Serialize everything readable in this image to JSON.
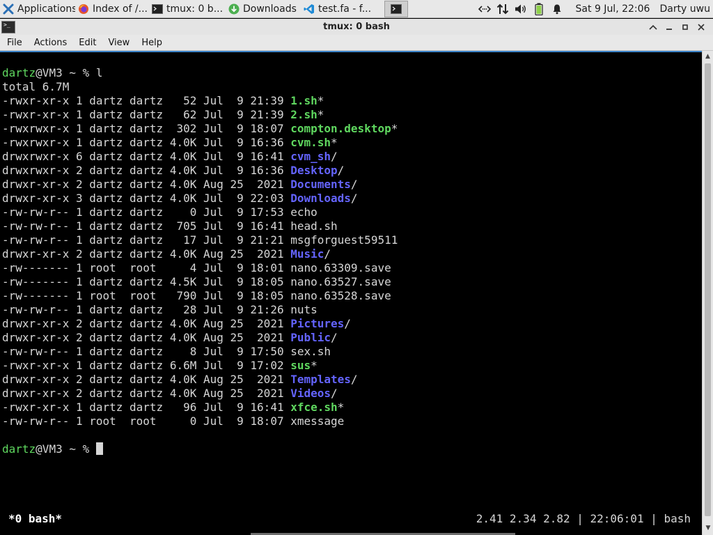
{
  "panel": {
    "tasks": [
      {
        "label": "Applications",
        "icon": "xfce-mouse-icon",
        "active": false
      },
      {
        "label": "Index of /...",
        "icon": "firefox-icon",
        "active": false
      },
      {
        "label": "tmux: 0 b...",
        "icon": "terminal-icon",
        "active": false
      },
      {
        "label": "Downloads",
        "icon": "download-folder-icon",
        "active": false
      },
      {
        "label": "test.fa - f...",
        "icon": "vscode-icon",
        "active": false
      },
      {
        "label": "",
        "icon": "terminal-icon",
        "active": true
      }
    ],
    "tray": [
      "network-icon",
      "transfer-icon",
      "volume-icon",
      "battery-icon",
      "notification-bell-icon"
    ],
    "clock": "Sat  9 Jul, 22:06",
    "user": "Darty uwu"
  },
  "window": {
    "title": "tmux: 0 bash",
    "menu": [
      "File",
      "Actions",
      "Edit",
      "View",
      "Help"
    ]
  },
  "terminal": {
    "prompt_user": "dartz",
    "prompt_host": "@VM3 ~ % ",
    "command": "l",
    "total": "total 6.7M",
    "entries": [
      {
        "meta": "-rwxr-xr-x 1 dartz dartz   52 Jul  9 21:39 ",
        "name": "1.sh",
        "suffix": "*",
        "kind": "exe"
      },
      {
        "meta": "-rwxr-xr-x 1 dartz dartz   62 Jul  9 21:39 ",
        "name": "2.sh",
        "suffix": "*",
        "kind": "exe"
      },
      {
        "meta": "-rwxrwxr-x 1 dartz dartz  302 Jul  9 18:07 ",
        "name": "compton.desktop",
        "suffix": "*",
        "kind": "exe"
      },
      {
        "meta": "-rwxrwxr-x 1 dartz dartz 4.0K Jul  9 16:36 ",
        "name": "cvm.sh",
        "suffix": "*",
        "kind": "exe"
      },
      {
        "meta": "drwxrwxr-x 6 dartz dartz 4.0K Jul  9 16:41 ",
        "name": "cvm_sh",
        "suffix": "/",
        "kind": "dir"
      },
      {
        "meta": "drwxrwxr-x 2 dartz dartz 4.0K Jul  9 16:36 ",
        "name": "Desktop",
        "suffix": "/",
        "kind": "dir"
      },
      {
        "meta": "drwxr-xr-x 2 dartz dartz 4.0K Aug 25  2021 ",
        "name": "Documents",
        "suffix": "/",
        "kind": "dir"
      },
      {
        "meta": "drwxr-xr-x 3 dartz dartz 4.0K Jul  9 22:03 ",
        "name": "Downloads",
        "suffix": "/",
        "kind": "dir"
      },
      {
        "meta": "-rw-rw-r-- 1 dartz dartz    0 Jul  9 17:53 ",
        "name": "echo",
        "suffix": "",
        "kind": "file"
      },
      {
        "meta": "-rw-rw-r-- 1 dartz dartz  705 Jul  9 16:41 ",
        "name": "head.sh",
        "suffix": "",
        "kind": "file"
      },
      {
        "meta": "-rw-rw-r-- 1 dartz dartz   17 Jul  9 21:21 ",
        "name": "msgforguest59511",
        "suffix": "",
        "kind": "file"
      },
      {
        "meta": "drwxr-xr-x 2 dartz dartz 4.0K Aug 25  2021 ",
        "name": "Music",
        "suffix": "/",
        "kind": "dir"
      },
      {
        "meta": "-rw------- 1 root  root     4 Jul  9 18:01 ",
        "name": "nano.63309.save",
        "suffix": "",
        "kind": "file"
      },
      {
        "meta": "-rw------- 1 dartz dartz 4.5K Jul  9 18:05 ",
        "name": "nano.63527.save",
        "suffix": "",
        "kind": "file"
      },
      {
        "meta": "-rw------- 1 root  root   790 Jul  9 18:05 ",
        "name": "nano.63528.save",
        "suffix": "",
        "kind": "file"
      },
      {
        "meta": "-rw-rw-r-- 1 dartz dartz   28 Jul  9 21:26 ",
        "name": "nuts",
        "suffix": "",
        "kind": "file"
      },
      {
        "meta": "drwxr-xr-x 2 dartz dartz 4.0K Aug 25  2021 ",
        "name": "Pictures",
        "suffix": "/",
        "kind": "dir"
      },
      {
        "meta": "drwxr-xr-x 2 dartz dartz 4.0K Aug 25  2021 ",
        "name": "Public",
        "suffix": "/",
        "kind": "dir"
      },
      {
        "meta": "-rw-rw-r-- 1 dartz dartz    8 Jul  9 17:50 ",
        "name": "sex.sh",
        "suffix": "",
        "kind": "file"
      },
      {
        "meta": "-rwxr-xr-x 1 dartz dartz 6.6M Jul  9 17:02 ",
        "name": "sus",
        "suffix": "*",
        "kind": "exe"
      },
      {
        "meta": "drwxr-xr-x 2 dartz dartz 4.0K Aug 25  2021 ",
        "name": "Templates",
        "suffix": "/",
        "kind": "dir"
      },
      {
        "meta": "drwxr-xr-x 2 dartz dartz 4.0K Aug 25  2021 ",
        "name": "Videos",
        "suffix": "/",
        "kind": "dir"
      },
      {
        "meta": "-rwxr-xr-x 1 dartz dartz   96 Jul  9 16:41 ",
        "name": "xfce.sh",
        "suffix": "*",
        "kind": "exe"
      },
      {
        "meta": "-rw-rw-r-- 1 root  root     0 Jul  9 18:07 ",
        "name": "xmessage",
        "suffix": "",
        "kind": "file"
      }
    ]
  },
  "tmux_status": {
    "left": "*0 bash*",
    "right": "2.41 2.34 2.82 | 22:06:01 | bash"
  },
  "colors": {
    "prompt_user": "#5fd75f",
    "executable": "#5fd75f",
    "directory": "#6464ff",
    "focus_border": "#3b83c9"
  }
}
